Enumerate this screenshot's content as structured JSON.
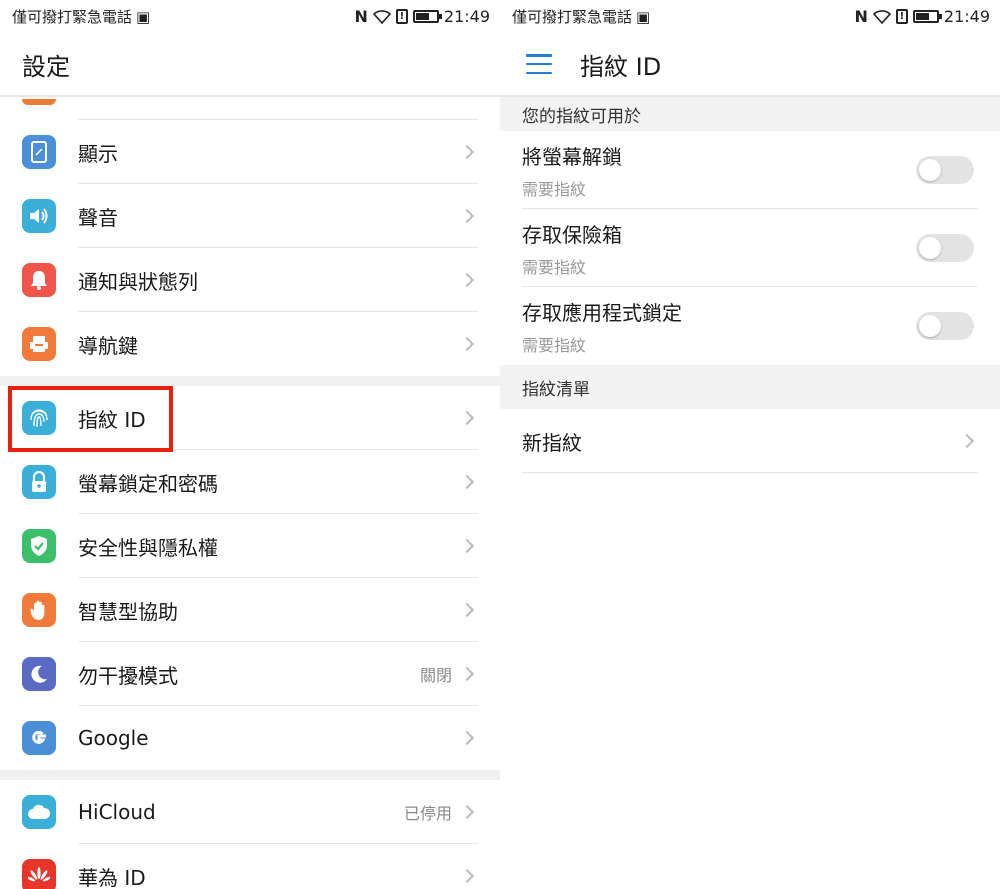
{
  "status_bar": {
    "carrier": "僅可撥打緊急電話",
    "time": "21:49"
  },
  "left": {
    "title": "設定",
    "items_group1": [
      {
        "label": "顯示",
        "icon": "display-icon",
        "color": "#4a8fd8"
      },
      {
        "label": "聲音",
        "icon": "speaker-icon",
        "color": "#3ab0d8"
      },
      {
        "label": "通知與狀態列",
        "icon": "bell-icon",
        "color": "#f0554a"
      },
      {
        "label": "導航鍵",
        "icon": "navigation-key-icon",
        "color": "#f07a3a"
      }
    ],
    "items_group2": [
      {
        "label": "指紋 ID",
        "icon": "fingerprint-icon",
        "color": "#3ab0d8"
      },
      {
        "label": "螢幕鎖定和密碼",
        "icon": "lock-icon",
        "color": "#3ab0d8"
      },
      {
        "label": "安全性與隱私權",
        "icon": "shield-icon",
        "color": "#3cbf6a"
      },
      {
        "label": "智慧型協助",
        "icon": "hand-icon",
        "color": "#f07a3a"
      },
      {
        "label": "勿干擾模式",
        "value": "關閉",
        "icon": "moon-icon",
        "color": "#5b6ac4"
      },
      {
        "label": "Google",
        "icon": "google-icon",
        "color": "#4a8fd8"
      }
    ],
    "items_group3": [
      {
        "label": "HiCloud",
        "value": "已停用",
        "icon": "cloud-icon",
        "color": "#3ab0d8"
      },
      {
        "label": "華為 ID",
        "icon": "huawei-icon",
        "color": "#e8352a"
      }
    ]
  },
  "right": {
    "title": "指紋 ID",
    "section1_title": "您的指紋可用於",
    "toggles": [
      {
        "title": "將螢幕解鎖",
        "subtitle": "需要指紋",
        "on": false
      },
      {
        "title": "存取保險箱",
        "subtitle": "需要指紋",
        "on": false
      },
      {
        "title": "存取應用程式鎖定",
        "subtitle": "需要指紋",
        "on": false
      }
    ],
    "section2_title": "指紋清單",
    "new_fingerprint": "新指紋"
  }
}
